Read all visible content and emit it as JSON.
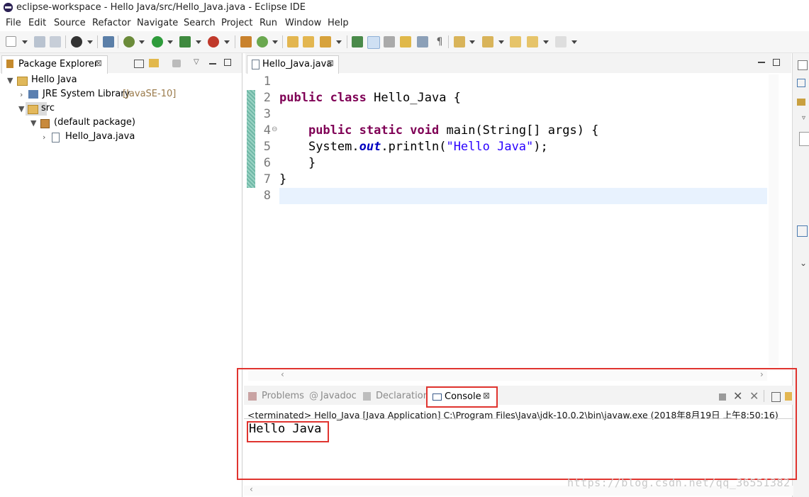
{
  "window": {
    "title": "eclipse-workspace - Hello Java/src/Hello_Java.java - Eclipse IDE"
  },
  "menu": [
    "File",
    "Edit",
    "Source",
    "Refactor",
    "Navigate",
    "Search",
    "Project",
    "Run",
    "Window",
    "Help"
  ],
  "package_explorer": {
    "title": "Package Explorer",
    "close": "⊠",
    "tree": {
      "project": "Hello Java",
      "jre": "JRE System Library",
      "jre_version": "[JavaSE-10]",
      "src": "src",
      "package": "(default package)",
      "file": "Hello_Java.java"
    }
  },
  "editor": {
    "tab": "Hello_Java.java",
    "close": "⊠",
    "line_numbers": [
      "1",
      "2",
      "3",
      "4",
      "5",
      "6",
      "7",
      "8"
    ],
    "fold_marker": "⊖",
    "code": {
      "l2_kw1": "public",
      "l2_kw2": "class",
      "l2_rest": " Hello_Java {",
      "l4_kw1": "public",
      "l4_kw2": "static",
      "l4_kw3": "void",
      "l4_rest": " main(String[] args) {",
      "l5_a": "System.",
      "l5_field": "out",
      "l5_b": ".println(",
      "l5_str": "\"Hello Java\"",
      "l5_c": ");",
      "l6": "}",
      "l7": "}"
    }
  },
  "bottom": {
    "tabs": {
      "problems": "Problems",
      "javadoc": "Javadoc",
      "declaration": "Declaration",
      "console": "Console"
    },
    "close": "⊠",
    "status": "<terminated> Hello_Java [Java Application] C:\\Program Files\\Java\\jdk-10.0.2\\bin\\javaw.exe (2018年8月19日 上午8:50:16)",
    "output": "Hello Java"
  },
  "watermark": "https://blog.csdn.net/qq_36551382",
  "colors": {
    "keyword": "#7f0055",
    "string": "#2a00ff",
    "field": "#0000c0",
    "highlight_box": "#e0342f",
    "current_line": "#e8f2fe"
  }
}
